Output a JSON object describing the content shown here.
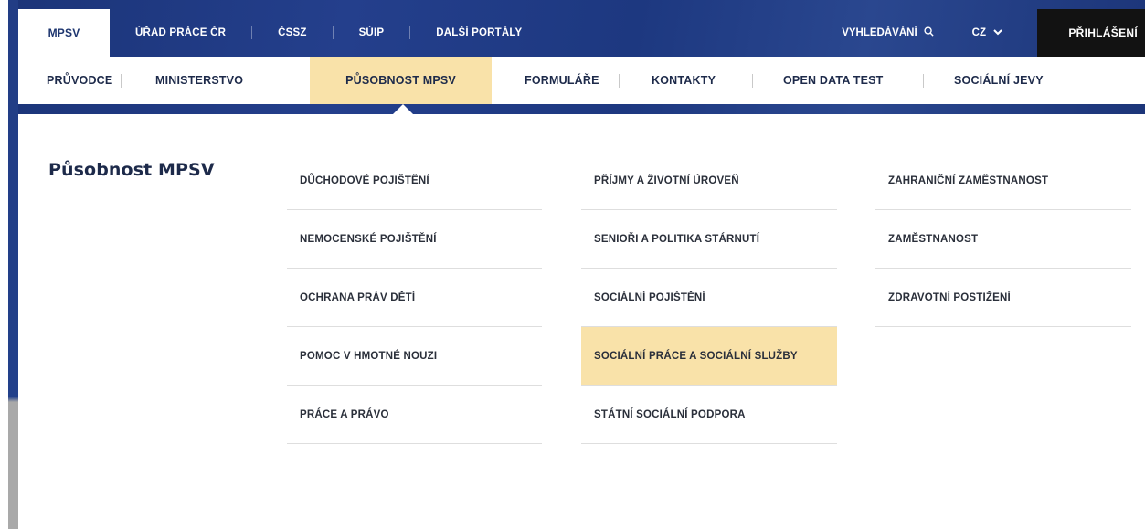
{
  "topbar": {
    "home": "MPSV",
    "links": [
      "ÚŘAD PRÁCE ČR",
      "ČSSZ",
      "SÚIP",
      "DALŠÍ PORTÁLY"
    ],
    "search_label": "VYHLEDÁVÁNÍ",
    "lang_label": "CZ",
    "login_label": "PŘIHLÁŠENÍ"
  },
  "mainnav": {
    "items": [
      "PRŮVODCE",
      "MINISTERSTVO",
      "PŮSOBNOST MPSV",
      "FORMULÁŘE",
      "KONTAKTY",
      "OPEN DATA TEST",
      "SOCIÁLNÍ JEVY"
    ],
    "active_index": 2
  },
  "dropdown": {
    "title": "Působnost MPSV",
    "col1": [
      "DŮCHODOVÉ POJIŠTĚNÍ",
      "NEMOCENSKÉ POJIŠTĚNÍ",
      "OCHRANA PRÁV DĚTÍ",
      "POMOC V HMOTNÉ NOUZI",
      "PRÁCE A PRÁVO"
    ],
    "col2": [
      "PŘÍJMY A ŽIVOTNÍ ÚROVEŇ",
      "SENIOŘI A POLITIKA STÁRNUTÍ",
      "SOCIÁLNÍ POJIŠTĚNÍ",
      "SOCIÁLNÍ PRÁCE A SOCIÁLNÍ SLUŽBY",
      "STÁTNÍ SOCIÁLNÍ PODPORA"
    ],
    "col3": [
      "ZAHRANIČNÍ ZAMĚSTNANOST",
      "ZAMĚSTNANOST",
      "ZDRAVOTNÍ POSTIŽENÍ"
    ],
    "active_item": "SOCIÁLNÍ PRÁCE A SOCIÁLNÍ SLUŽBY"
  },
  "colors": {
    "brand_blue": "#1b3478",
    "highlight": "#f9e2a9",
    "login_bg": "#121212"
  },
  "icons": {
    "search": "search-icon",
    "lang_dropdown": "chevron-down-icon"
  }
}
